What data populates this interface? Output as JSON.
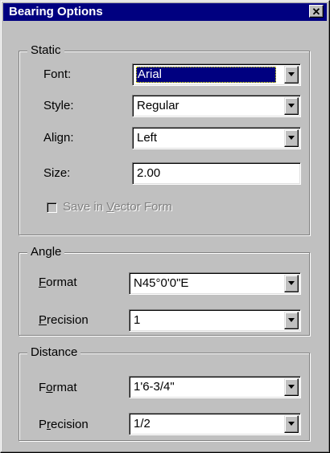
{
  "window": {
    "title": "Bearing Options",
    "close_glyph": "✕"
  },
  "static_group": {
    "legend": "Static",
    "font": {
      "label": "Font:",
      "value": "Arial"
    },
    "style": {
      "label": "Style:",
      "value": "Regular"
    },
    "align": {
      "label": "Align:",
      "value": "Left"
    },
    "size": {
      "label": "Size:",
      "value": "2.00"
    },
    "vector_form": {
      "label_pre": "Save in ",
      "label_accel": "V",
      "label_post": "ector Form",
      "checked": false,
      "enabled": false
    }
  },
  "angle_group": {
    "legend": "Angle",
    "format": {
      "label_accel": "F",
      "label_rest": "ormat",
      "value": "N45°0'0\"E"
    },
    "precision": {
      "label_accel": "P",
      "label_rest": "recision",
      "value": "1"
    }
  },
  "distance_group": {
    "legend": "Distance",
    "format": {
      "label_pre": "F",
      "label_accel": "o",
      "label_rest": "rmat",
      "value": "1'6-3/4\""
    },
    "precision": {
      "label_pre": "P",
      "label_accel": "r",
      "label_rest": "ecision",
      "value": "1/2"
    }
  },
  "colors": {
    "title_bar": "#000080",
    "face": "#c0c0c0",
    "selection": "#000080"
  },
  "icons": {
    "dropdown": "chevron-down-icon",
    "close": "close-icon"
  }
}
